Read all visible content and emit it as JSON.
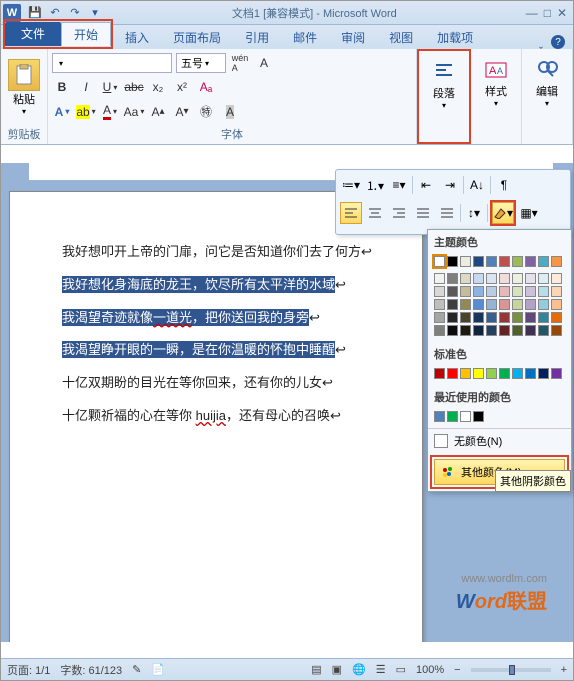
{
  "app": {
    "title": "文档1 [兼容模式] - Microsoft Word",
    "word_icon": "W"
  },
  "qat": {
    "save": "💾",
    "undo": "↶",
    "redo": "↷",
    "custom": "▾"
  },
  "win": {
    "min": "—",
    "max": "□",
    "close": "✕",
    "ribmin": "ˬ",
    "help": "?"
  },
  "tabs": {
    "file": "文件",
    "home": "开始",
    "insert": "插入",
    "layout": "页面布局",
    "references": "引用",
    "mailings": "邮件",
    "review": "审阅",
    "view": "视图",
    "addins": "加载项"
  },
  "ribbon": {
    "clipboard": {
      "paste": "粘贴",
      "label": "剪贴板"
    },
    "font": {
      "family": "",
      "size": "五号",
      "label": "字体",
      "grow": "A",
      "shrink": "A",
      "changecase": "Aa",
      "clear": "⌫"
    },
    "paragraph": {
      "label": "段落"
    },
    "styles": {
      "label": "样式"
    },
    "editing": {
      "label": "编辑",
      "find": "🔍"
    }
  },
  "mini": {
    "bullets": "≔",
    "numbering": "≕",
    "multilevel": "≡",
    "dedent": "⇤",
    "indent": "⇥",
    "sort": "A↓",
    "marks": "¶",
    "al": "≡",
    "ac": "≡",
    "ar": "≡",
    "aj": "≡",
    "dist": "≡",
    "ls": "↕",
    "shade": "◢",
    "border": "▦"
  },
  "picker": {
    "theme_label": "主题颜色",
    "std_label": "标准色",
    "recent_label": "最近使用的颜色",
    "none_label": "无颜色(N)",
    "more_label": "其他颜色(M)...",
    "tooltip": "其他阴影颜色",
    "theme_row0": [
      "#ffffff",
      "#000000",
      "#eeece1",
      "#1f497d",
      "#4f81bd",
      "#c0504d",
      "#9bbb59",
      "#8064a2",
      "#4bacc6",
      "#f79646"
    ],
    "theme_rows": [
      [
        "#f2f2f2",
        "#7f7f7f",
        "#ddd9c3",
        "#c6d9f0",
        "#dbe5f1",
        "#f2dcdb",
        "#ebf1dd",
        "#e5e0ec",
        "#dbeef3",
        "#fdeada"
      ],
      [
        "#d8d8d8",
        "#595959",
        "#c4bd97",
        "#8db3e2",
        "#b8cce4",
        "#e5b9b7",
        "#d7e3bc",
        "#ccc1d9",
        "#b7dde8",
        "#fbd5b5"
      ],
      [
        "#bfbfbf",
        "#3f3f3f",
        "#938953",
        "#548dd4",
        "#95b3d7",
        "#d99694",
        "#c3d69b",
        "#b2a2c7",
        "#92cddc",
        "#fac08f"
      ],
      [
        "#a5a5a5",
        "#262626",
        "#494429",
        "#17365d",
        "#366092",
        "#953734",
        "#76923c",
        "#5f497a",
        "#31859b",
        "#e36c09"
      ],
      [
        "#7f7f7f",
        "#0c0c0c",
        "#1d1b10",
        "#0f243e",
        "#244061",
        "#632423",
        "#4f6128",
        "#3f3151",
        "#205867",
        "#974806"
      ]
    ],
    "standard": [
      "#c00000",
      "#ff0000",
      "#ffc000",
      "#ffff00",
      "#92d050",
      "#00b050",
      "#00b0f0",
      "#0070c0",
      "#002060",
      "#7030a0"
    ],
    "recent": [
      "#4f81bd",
      "#00b050",
      "#ffffff",
      "#000000"
    ]
  },
  "doc": {
    "p1": "我好想叩开上帝的门扉，问它是否知道你们去了何方",
    "p2": "我好想化身海底的龙王，饮尽所有太平洋的水域",
    "p3a": "我渴望奇迹就像",
    "p3b": "一道光",
    "p3c": "，把你送回我的身旁",
    "p4": "我渴望睁开眼的一瞬，是在你温暖的怀抱中睡醒",
    "p5": "十亿双期盼的目光在等你回来，还有你的儿女",
    "p6a": "十亿颗祈福的心在等你 ",
    "p6b": "huijia",
    "p6c": "，还有母心的召唤"
  },
  "status": {
    "page": "页面: 1/1",
    "words": "字数: 61/123",
    "lang": "🖝",
    "zoom": "100%"
  },
  "watermark": {
    "w": "W",
    "ord": "ord",
    "ch": "联盟",
    "url": "www.wordlm.com"
  }
}
